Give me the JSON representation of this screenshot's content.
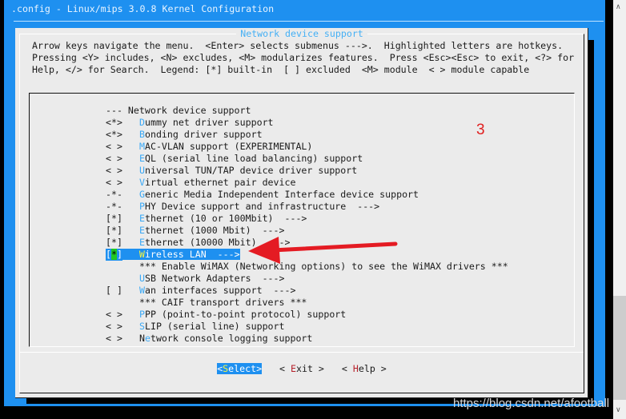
{
  "window_title": ".config - Linux/mips 3.0.8 Kernel Configuration",
  "dialog": {
    "title": "Network device support",
    "help_text": "Arrow keys navigate the menu.  <Enter> selects submenus --->.  Highlighted letters are hotkeys.\nPressing <Y> includes, <N> excludes, <M> modularizes features.  Press <Esc><Esc> to exit, <?> for\nHelp, </> for Search.  Legend: [*] built-in  [ ] excluded  <M> module  < > module capable"
  },
  "menu": [
    {
      "prefix": "",
      "pre_hk": "",
      "hk": "",
      "text": "--- Network device support",
      "indent": false
    },
    {
      "prefix": "<*>",
      "pre_hk": "",
      "hk": "D",
      "text": "ummy net driver support",
      "indent": true
    },
    {
      "prefix": "<*>",
      "pre_hk": "",
      "hk": "B",
      "text": "onding driver support",
      "indent": true
    },
    {
      "prefix": "< >",
      "pre_hk": "",
      "hk": "M",
      "text": "AC-VLAN support (EXPERIMENTAL)",
      "indent": true
    },
    {
      "prefix": "< >",
      "pre_hk": "",
      "hk": "E",
      "text": "QL (serial line load balancing) support",
      "indent": true
    },
    {
      "prefix": "< >",
      "pre_hk": "",
      "hk": "U",
      "text": "niversal TUN/TAP device driver support",
      "indent": true
    },
    {
      "prefix": "< >",
      "pre_hk": "",
      "hk": "V",
      "text": "irtual ethernet pair device",
      "indent": true
    },
    {
      "prefix": "-*-",
      "pre_hk": "",
      "hk": "G",
      "text": "eneric Media Independent Interface device support",
      "indent": true
    },
    {
      "prefix": "-*-",
      "pre_hk": "",
      "hk": "P",
      "text": "HY Device support and infrastructure  --->",
      "indent": true
    },
    {
      "prefix": "[*]",
      "pre_hk": "",
      "hk": "E",
      "text": "thernet (10 or 100Mbit)  --->",
      "indent": true
    },
    {
      "prefix": "[*]",
      "pre_hk": "",
      "hk": "E",
      "text": "thernet (1000 Mbit)  --->",
      "indent": true
    },
    {
      "prefix": "[*]",
      "pre_hk": "",
      "hk": "E",
      "text": "thernet (10000 Mbit)  --->",
      "indent": true
    },
    {
      "prefix": "[*]",
      "pre_hk": "",
      "hk": "W",
      "text": "ireless LAN  --->",
      "indent": true,
      "selected": true
    },
    {
      "prefix": "",
      "pre_hk": "",
      "hk": "",
      "text": "*** Enable WiMAX (Networking options) to see the WiMAX drivers ***",
      "indent": true
    },
    {
      "prefix": "",
      "pre_hk": "",
      "hk": "U",
      "text": "SB Network Adapters  --->",
      "indent": true
    },
    {
      "prefix": "[ ]",
      "pre_hk": "",
      "hk": "W",
      "text": "an interfaces support  --->",
      "indent": true
    },
    {
      "prefix": "",
      "pre_hk": "",
      "hk": "",
      "text": "*** CAIF transport drivers ***",
      "indent": true
    },
    {
      "prefix": "< >",
      "pre_hk": "",
      "hk": "P",
      "text": "PP (point-to-point protocol) support",
      "indent": true
    },
    {
      "prefix": "< >",
      "pre_hk": "",
      "hk": "S",
      "text": "LIP (serial line) support",
      "indent": true
    },
    {
      "prefix": "< >",
      "pre_hk": "N",
      "hk": "e",
      "text": "twork console logging support",
      "indent": true
    }
  ],
  "buttons": [
    {
      "open": "<",
      "hk": "S",
      "rest": "elect",
      "close": ">",
      "selected": true
    },
    {
      "open": "< ",
      "hk": "E",
      "rest": "xit",
      "close": " >",
      "selected": false
    },
    {
      "open": "< ",
      "hk": "H",
      "rest": "elp",
      "close": " >",
      "selected": false
    }
  ],
  "annotation": "3",
  "watermark": "https://blog.csdn.net/afootball",
  "colors": {
    "terminal_bg": "#1e90f0",
    "dialog_bg": "#ebebeb",
    "hotkey": "#3aa8f5",
    "annotation": "#e02020"
  }
}
